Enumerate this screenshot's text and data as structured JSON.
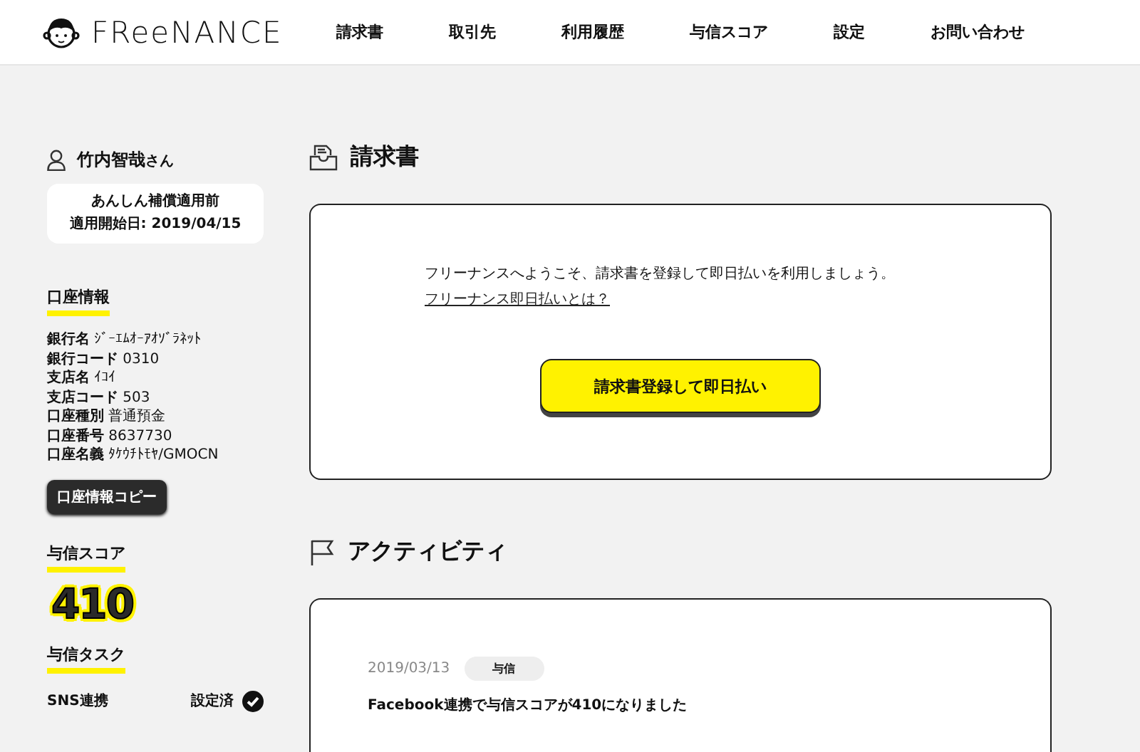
{
  "header": {
    "logo": "FReeNANCE",
    "nav": [
      {
        "label": "請求書"
      },
      {
        "label": "取引先"
      },
      {
        "label": "利用履歴"
      },
      {
        "label": "与信スコア"
      },
      {
        "label": "設定"
      },
      {
        "label": "お問い合わせ"
      }
    ]
  },
  "sidebar": {
    "user_name": "竹内智哉",
    "honorific": "さん",
    "status_lines": [
      "あんしん補償適用前",
      "適用開始日: 2019/04/15"
    ],
    "account": {
      "heading": "口座情報",
      "rows": [
        {
          "label": "銀行名",
          "value": "ｼﾞｰｴﾑｵｰｱｵｿﾞﾗﾈｯﾄ"
        },
        {
          "label": "銀行コード",
          "value": "0310"
        },
        {
          "label": "支店名",
          "value": "ｲｺｲ"
        },
        {
          "label": "支店コード",
          "value": "503"
        },
        {
          "label": "口座種別",
          "value": "普通預金"
        },
        {
          "label": "口座番号",
          "value": "8637730"
        },
        {
          "label": "口座名義",
          "value": "ﾀｹｳﾁﾄﾓﾔ/GMOCN"
        }
      ],
      "copy_button": "口座情報コピー"
    },
    "score": {
      "heading": "与信スコア",
      "value": "410"
    },
    "tasks": {
      "heading": "与信タスク",
      "items": [
        {
          "label": "SNS連携",
          "status": "設定済",
          "done": true
        }
      ]
    }
  },
  "main": {
    "invoice": {
      "title": "請求書",
      "message": "フリーナンスへようこそ、請求書を登録して即日払いを利用しましょう。",
      "link": "フリーナンス即日払いとは？",
      "button": "請求書登録して即日払い"
    },
    "activity": {
      "title": "アクティビティ",
      "items": [
        {
          "date": "2019/03/13",
          "tag": "与信",
          "text": "Facebook連携で与信スコアが410になりました"
        }
      ]
    }
  }
}
